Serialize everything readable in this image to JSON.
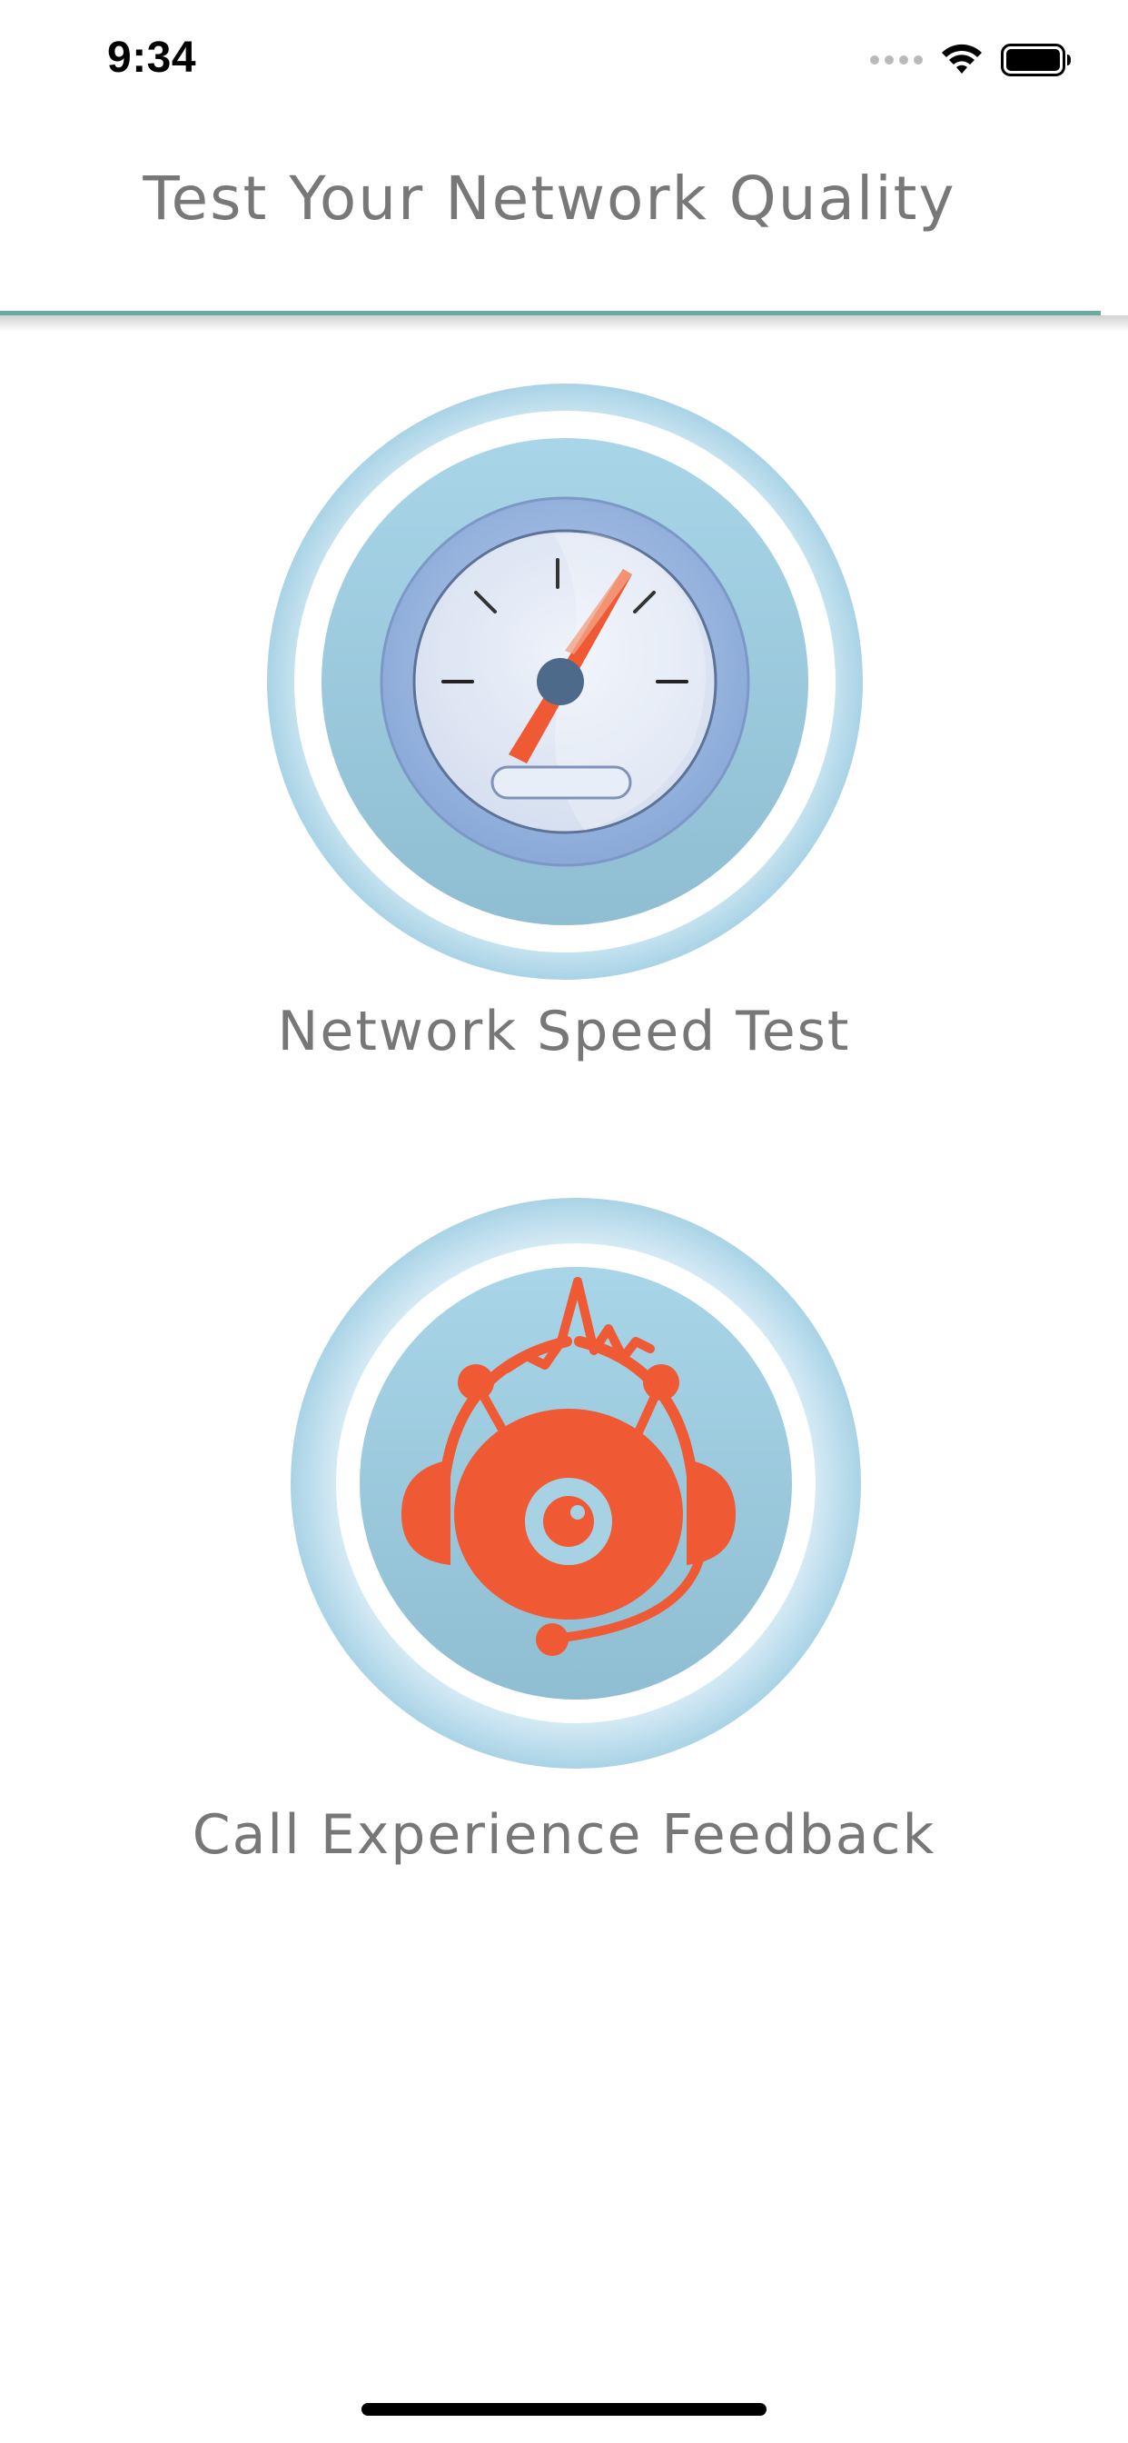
{
  "status_bar": {
    "time": "9:34",
    "icons": [
      "signal-dots-icon",
      "wifi-icon",
      "battery-icon"
    ]
  },
  "header": {
    "title": "Test Your Network Quality"
  },
  "options": [
    {
      "label": "Network Speed Test",
      "icon": "speedometer-icon"
    },
    {
      "label": "Call Experience Feedback",
      "icon": "headset-feedback-icon"
    }
  ],
  "colors": {
    "title_text": "#787878",
    "header_line": "#6aaaa0",
    "icon_ring": "#a9d3e6",
    "icon_inner": "#9fc7da",
    "accent_orange": "#ef5a34",
    "label_text": "#777777"
  }
}
